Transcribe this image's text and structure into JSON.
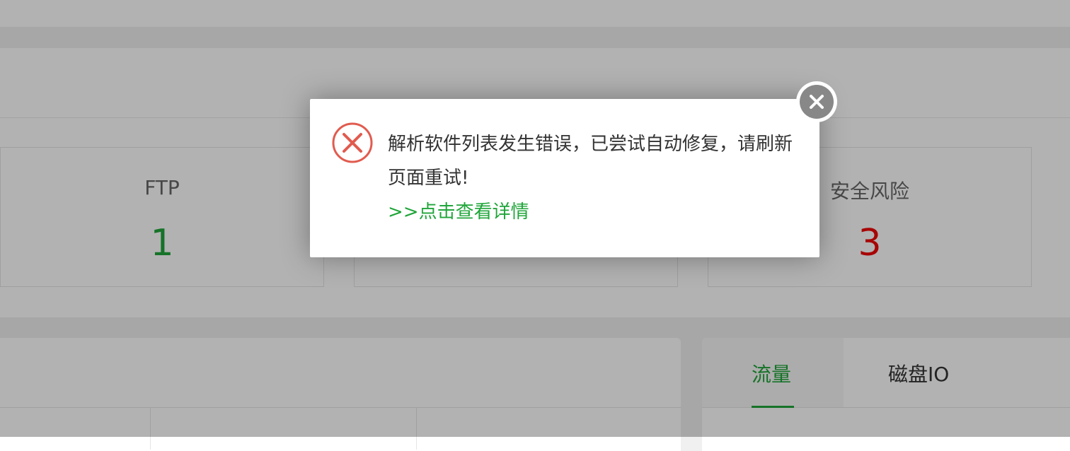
{
  "stats": [
    {
      "label": "FTP",
      "value": "1",
      "color": "#20a53a"
    },
    {
      "label": "",
      "value": "",
      "color": "#20a53a"
    },
    {
      "label": "安全风险",
      "value": "3",
      "color": "#ef0808"
    }
  ],
  "monitor_tabs": [
    {
      "label": "流量",
      "active": true
    },
    {
      "label": "磁盘IO",
      "active": false
    }
  ],
  "dialog": {
    "icon": "error-circle-icon",
    "message": "解析软件列表发生错误，已尝试自动修复，请刷新页面重试!",
    "detail_link": ">>点击查看详情",
    "close_icon": "close-icon"
  },
  "colors": {
    "accent_green": "#20a53a",
    "danger_red": "#ef0808",
    "overlay": "rgba(0,0,0,0.3)"
  }
}
